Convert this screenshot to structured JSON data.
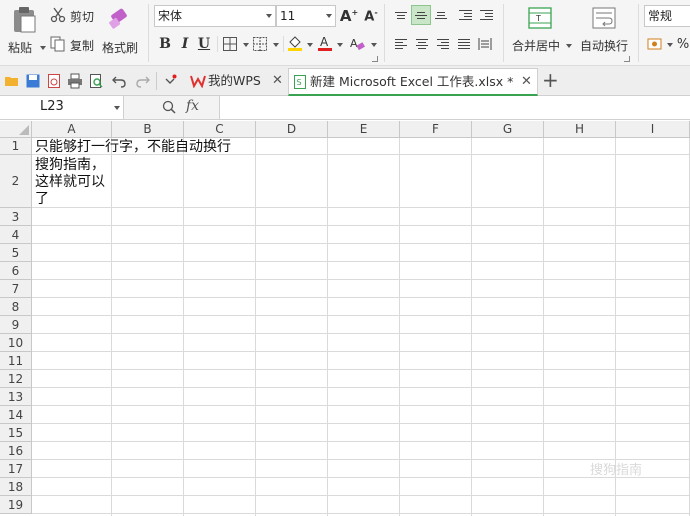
{
  "ribbon": {
    "paste_label": "粘贴",
    "cut_label": "剪切",
    "copy_label": "复制",
    "format_painter_label": "格式刷",
    "font_name": "宋体",
    "font_size": "11",
    "bold_label": "B",
    "italic_label": "I",
    "underline_label": "U",
    "merge_center_label": "合并居中",
    "wrap_text_label": "自动换行",
    "number_format": "常规",
    "percent_label": "%"
  },
  "tabs": {
    "wps_tab_label": "我的WPS",
    "file_tab_label": "新建 Microsoft Excel 工作表.xlsx *",
    "add_tab_label": "+"
  },
  "formula_bar": {
    "name_box": "L23",
    "fx_label": "fx"
  },
  "sheet": {
    "columns": [
      "A",
      "B",
      "C",
      "D",
      "E",
      "F",
      "G",
      "H",
      "I"
    ],
    "rows": [
      "1",
      "2",
      "3",
      "4",
      "5",
      "6",
      "7",
      "8",
      "9",
      "10",
      "11",
      "12",
      "13",
      "14",
      "15",
      "16",
      "17",
      "18",
      "19"
    ],
    "cells": {
      "A1": "只能够打一行字，不能自动换行",
      "A2_line1": "搜狗指南，",
      "A2_line2": "这样就可以",
      "A2_line3": "了"
    }
  },
  "watermark": "搜狗指南",
  "colors": {
    "accent_green": "#3aa352",
    "active_align_bg": "#c9e6c9",
    "font_color_red": "#e02020",
    "fill_yellow": "#ffd400"
  }
}
